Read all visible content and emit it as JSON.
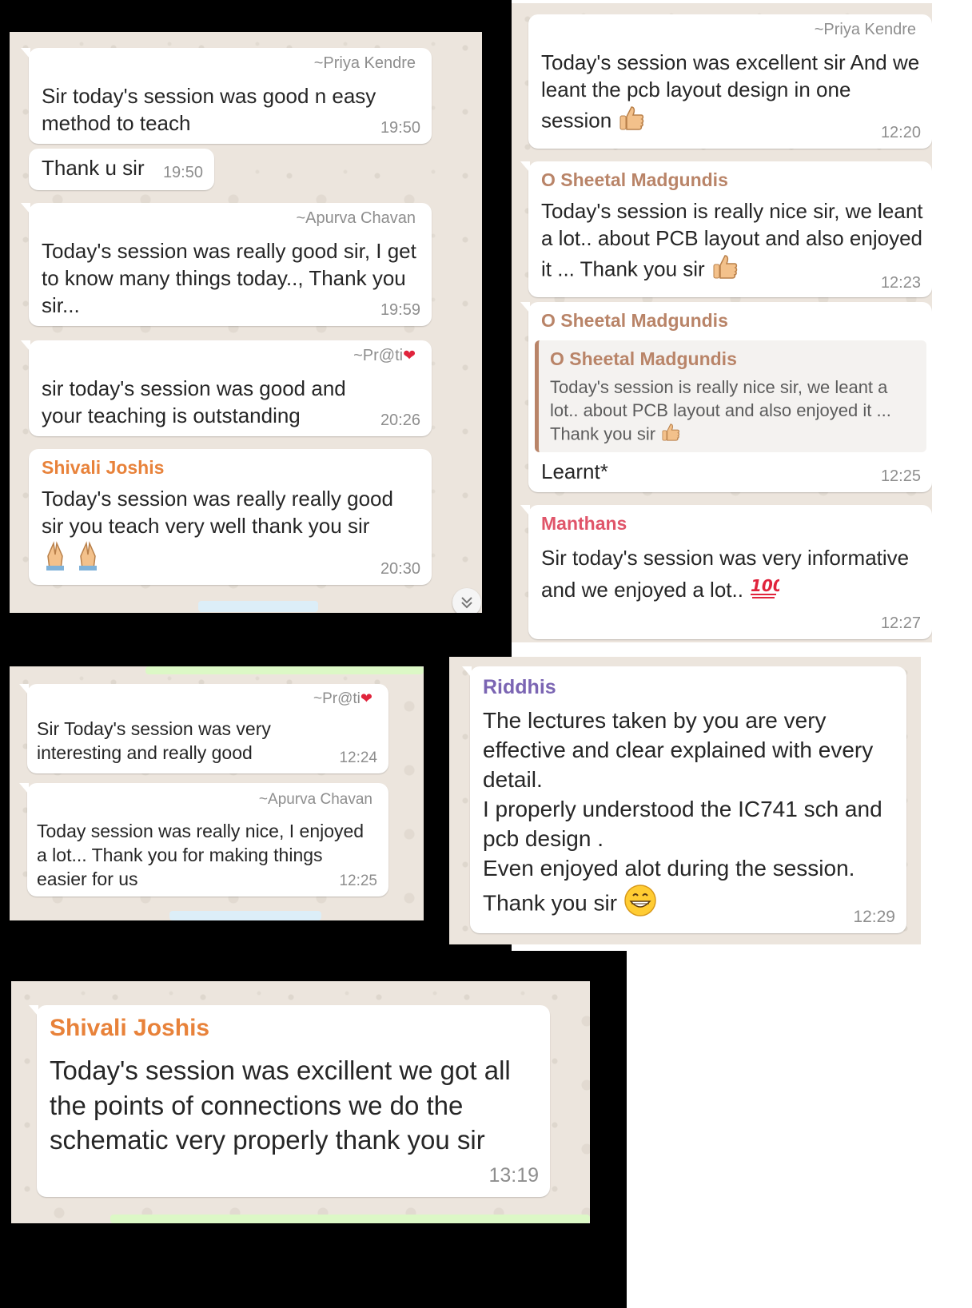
{
  "colors": {
    "chat_bg": "#ece5dd",
    "bubble_bg": "#ffffff",
    "time_gray": "#8e8e8e",
    "shivali": "#e8823a",
    "sheetal": "#b98468",
    "manthans": "#e0556a",
    "riddhis": "#7b65b3"
  },
  "panel1": {
    "m1": {
      "sender": "~Priya Kendre",
      "text": "Sir today's session was good n easy method to teach",
      "time": "19:50"
    },
    "m2": {
      "text": "Thank u sir",
      "time": "19:50"
    },
    "m3": {
      "sender": "~Apurva Chavan",
      "text": "Today's session was really good sir, I get to know many things today.., Thank you sir...",
      "time": "19:59"
    },
    "m4": {
      "sender": "~Pr@ti",
      "text": "sir today's session was good and your teaching is outstanding",
      "time": "20:26"
    },
    "m5": {
      "sender": "Shivali Joshis",
      "text": "Today's session was really really good sir you teach very well thank you sir",
      "time": "20:30"
    }
  },
  "panel2": {
    "m1": {
      "sender": "~Priya Kendre",
      "text": "Today's session was excellent sir And we leant the pcb layout design in one session",
      "time": "12:20"
    },
    "m2": {
      "sender": "O Sheetal Madgundis",
      "text": "Today's session is really nice sir, we leant a lot.. about PCB layout and also enjoyed it ... Thank you sir",
      "time": "12:23"
    },
    "m3": {
      "sender": "O Sheetal Madgundis",
      "quote_sender": "O Sheetal Madgundis",
      "quote_text": "Today's session is really nice sir, we leant a lot.. about PCB layout and also enjoyed it ... Thank you sir",
      "text": "Learnt*",
      "time": "12:25"
    },
    "m4": {
      "sender": "Manthans",
      "text": "Sir today's session was very informative and we enjoyed a lot..",
      "time": "12:27"
    }
  },
  "panel3": {
    "m1": {
      "sender": "~Pr@ti",
      "text": "Sir Today's session was very interesting and really  good",
      "time": "12:24"
    },
    "m2": {
      "sender": "~Apurva Chavan",
      "text": "Today session was really nice, I enjoyed a lot... Thank you for making things easier for us",
      "time": "12:25"
    }
  },
  "panel4": {
    "m1": {
      "sender": "Riddhis",
      "line1": "The lectures taken by you are very effective and clear explained with every detail.",
      "line2": "I properly understood the IC741 sch and pcb design .",
      "line3": "Even enjoyed alot during the session.",
      "line4": "Thank you sir",
      "time": "12:29"
    }
  },
  "panel5": {
    "m1": {
      "sender": "Shivali Joshis",
      "text": "Today's session was excillent we got all the points of connections we do the schematic very properly thank you sir",
      "time": "13:19"
    }
  },
  "icons": [
    "thumbs-up-icon",
    "folded-hands-icon",
    "hundred-points-icon",
    "grinning-face-icon",
    "heart-icon",
    "scroll-down-icon"
  ]
}
